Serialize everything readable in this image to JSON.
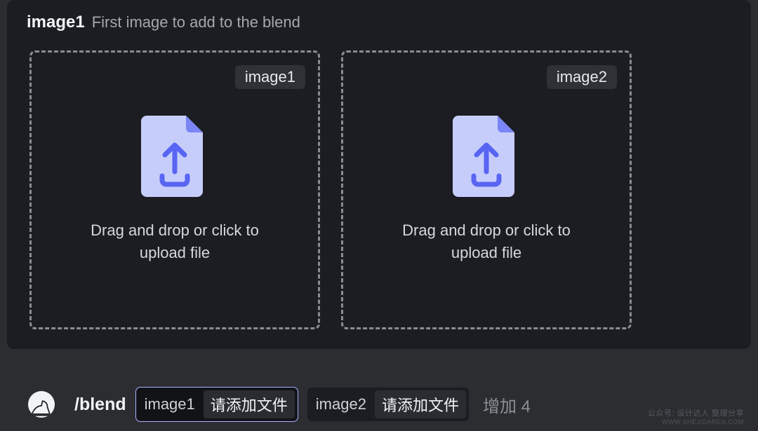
{
  "header": {
    "param_name": "image1",
    "description": "First image to add to the blend"
  },
  "dropzones": [
    {
      "label": "image1",
      "hint": "Drag and drop or click to upload file"
    },
    {
      "label": "image2",
      "hint": "Drag and drop or click to upload file"
    }
  ],
  "command": {
    "slash": "/blend",
    "params": [
      {
        "key": "image1",
        "value": "请添加文件",
        "active": true
      },
      {
        "key": "image2",
        "value": "请添加文件",
        "active": false
      }
    ],
    "add_more": "增加 4"
  },
  "watermark": {
    "line1": "公众号: 设计达人 整理分享",
    "line2": "WWW.SHEJIDAREN.COM"
  },
  "colors": {
    "file_fill": "#c7cdfb",
    "file_fold": "#7a86f5",
    "arrow": "#5865f2"
  }
}
